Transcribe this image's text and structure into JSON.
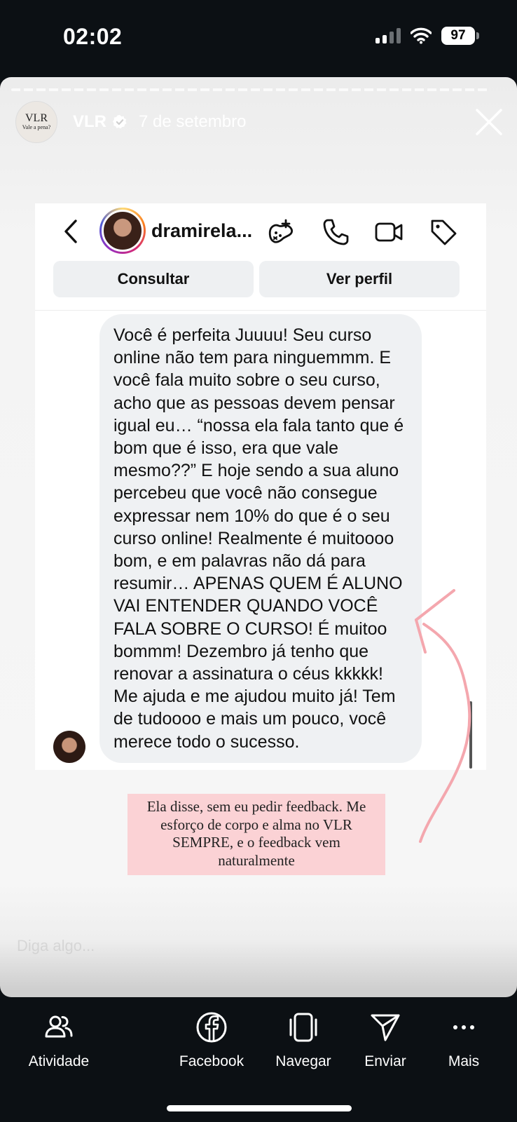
{
  "status_bar": {
    "time": "02:02",
    "battery": "97"
  },
  "story": {
    "avatar_logo_big": "VLR",
    "avatar_logo_small": "Vale a pena?",
    "username": "VLR",
    "date": "7 de setembro",
    "reply_placeholder": "Diga algo..."
  },
  "dm": {
    "contact_name": "dramirela...",
    "consult_button": "Consultar",
    "profile_button": "Ver perfil",
    "message": "Você é perfeita Juuuu! Seu curso online não tem para ninguemmm. E você fala muito sobre o seu curso, acho que as pessoas devem pensar igual eu… “nossa ela fala tanto que é bom que é isso, era que vale mesmo??” E hoje sendo a sua aluno percebeu que você não consegue expressar nem 10% do que é o seu curso online! Realmente é muitoooo bom, e em palavras não dá para resumir… APENAS QUEM É ALUNO VAI ENTENDER QUANDO VOCÊ FALA SOBRE O CURSO! É muitoo bommm! Dezembro já tenho que renovar a assinatura o céus kkkkk! Me ajuda e me ajudou muito já! Tem de tudoooo e mais um pouco, você merece todo o sucesso."
  },
  "caption": "Ela disse, sem eu pedir feedback. Me esforço de corpo e alma no VLR SEMPRE, e o feedback vem naturalmente",
  "bottom_nav": {
    "activity": "Atividade",
    "facebook": "Facebook",
    "browse": "Navegar",
    "send": "Enviar",
    "more": "Mais"
  },
  "colors": {
    "caption_bg": "#fbd2d5",
    "arrow": "#f4a7ae",
    "bar_bg": "#0c1014"
  }
}
